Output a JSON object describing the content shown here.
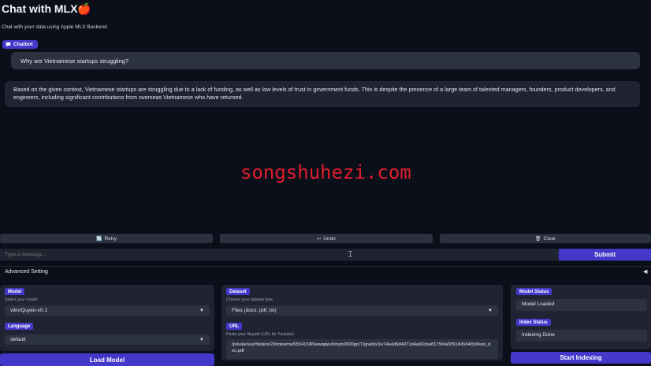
{
  "header": {
    "title": "Chat with MLX🍎",
    "subtitle": "Chat with your data using Apple MLX Backend"
  },
  "chatbot": {
    "label": "Chatbot",
    "messages": [
      {
        "role": "user",
        "text": "Why are Vietnamese startups struggling?"
      },
      {
        "role": "bot",
        "text": "Based on the given context, Vietnamese startups are struggling due to a lack of funding, as well as low levels of trust in government funds. This is despite the presence of a large team of talented managers, founders, product developers, and engineers, including significant contributions from overseas Vietnamese who have returned."
      }
    ]
  },
  "watermark": "songshuhezi.com",
  "actions": {
    "retry": "Retry",
    "undo": "Undo",
    "clear": "Clear",
    "retry_icon": "🔄",
    "undo_icon": "↩",
    "clear_icon": "🗑"
  },
  "input": {
    "placeholder": "Type a message...",
    "submit": "Submit"
  },
  "advanced": {
    "label": "Advanced Setting",
    "caret": "◀"
  },
  "model": {
    "label": "Model",
    "hint": "Select your model",
    "value": "vilm/Quyen-v0.1",
    "load_button": "Load Model"
  },
  "language": {
    "label": "Language",
    "value": "default"
  },
  "dataset": {
    "label": "Dataset",
    "hint": "Choose your dataset type",
    "value": "Files (docx, pdf, txt)"
  },
  "url": {
    "label": "URL",
    "hint": "Paste your filepath (URL for Youtube)",
    "value": "/private/var/folders/29/mkwmw555415l99wwqqwv5mph0000gn/T/gradio/1e74a4d6d4071d4a60cbe8175f4af2f9184584f3d/test_doc.pdf"
  },
  "model_status": {
    "label": "Model Status",
    "value": "Model Loaded"
  },
  "index_status": {
    "label": "Index Status",
    "value": "Indexing Done",
    "start_button": "Start Indexing"
  },
  "colors": {
    "accent": "#4338ca",
    "background": "#0b0f19",
    "panel": "#1f2333",
    "field": "#2d3241",
    "watermark": "#e11d2e"
  }
}
